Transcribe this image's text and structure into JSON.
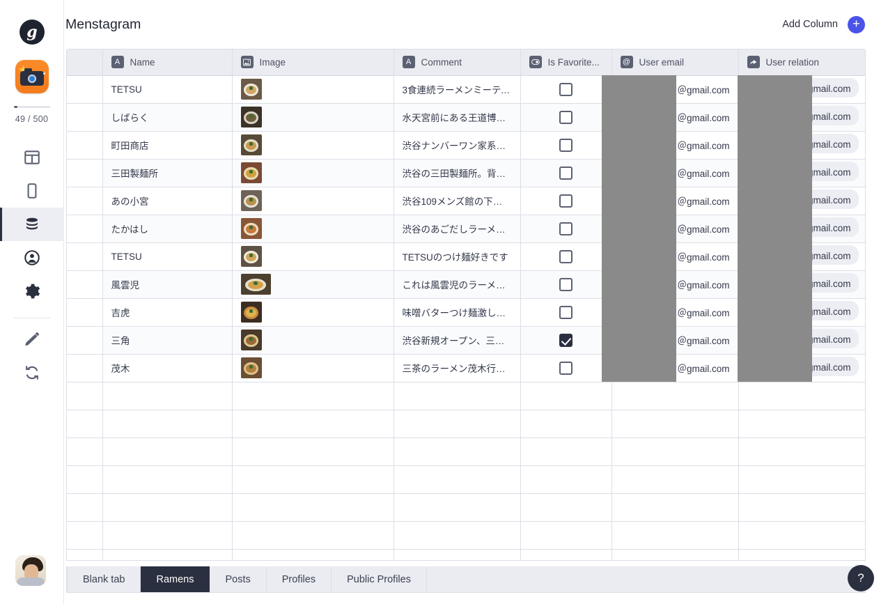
{
  "sidebar": {
    "brand_logo_letter": "g",
    "app_icon_name": "camera-app-icon",
    "quota": {
      "label": "49 / 500",
      "used": 49,
      "total": 500,
      "percent": 9.8
    },
    "nav_items": [
      {
        "name": "layout",
        "label": "Layout",
        "active": false
      },
      {
        "name": "mobile",
        "label": "Mobile preview",
        "active": false
      },
      {
        "name": "database",
        "label": "Database",
        "active": true
      },
      {
        "name": "users",
        "label": "Users",
        "active": false
      },
      {
        "name": "settings",
        "label": "Settings",
        "active": false
      },
      {
        "name": "design",
        "label": "Design",
        "active": false
      },
      {
        "name": "refresh",
        "label": "Refresh",
        "active": false
      }
    ],
    "avatar_label": "User avatar"
  },
  "header": {
    "title": "Menstagram",
    "add_column_label": "Add Column",
    "add_column_icon": "plus-icon"
  },
  "table": {
    "columns": [
      {
        "key": "gutter",
        "label": "",
        "icon": ""
      },
      {
        "key": "name",
        "label": "Name",
        "icon": "text-type-icon",
        "glyph": "A"
      },
      {
        "key": "image",
        "label": "Image",
        "icon": "image-type-icon",
        "glyph": "⛰"
      },
      {
        "key": "comment",
        "label": "Comment",
        "icon": "text-type-icon",
        "glyph": "A"
      },
      {
        "key": "fav",
        "label": "Is Favorite...",
        "icon": "toggle-type-icon",
        "glyph": "◉"
      },
      {
        "key": "email",
        "label": "User email",
        "icon": "email-type-icon",
        "glyph": "@"
      },
      {
        "key": "rel",
        "label": "User relation",
        "icon": "relation-type-icon",
        "glyph": "↱"
      }
    ],
    "rows": [
      {
        "name": "TETSU",
        "comment": "3食連続ラーメンミーティ…",
        "favorite": false,
        "email": "＠gmail.com",
        "relation": "＠gmail.com",
        "thumb_wide": false
      },
      {
        "name": "しばらく",
        "comment": "水天宮前にある王道博多…",
        "favorite": false,
        "email": "＠gmail.com",
        "relation": "＠gmail.com",
        "thumb_wide": false
      },
      {
        "name": "町田商店",
        "comment": "渋谷ナンバーワン家系ラー…",
        "favorite": false,
        "email": "＠gmail.com",
        "relation": "＠gmail.com",
        "thumb_wide": false
      },
      {
        "name": "三田製麺所",
        "comment": "渋谷の三田製麺所。背脂…",
        "favorite": false,
        "email": "＠gmail.com",
        "relation": "＠gmail.com",
        "thumb_wide": false
      },
      {
        "name": "あの小宮",
        "comment": "渋谷109メンズ館の下に出…",
        "favorite": false,
        "email": "＠gmail.com",
        "relation": "＠gmail.com",
        "thumb_wide": false
      },
      {
        "name": "たかはし",
        "comment": "渋谷のあごだしラーメン2…",
        "favorite": false,
        "email": "＠gmail.com",
        "relation": "＠gmail.com",
        "thumb_wide": false
      },
      {
        "name": "TETSU",
        "comment": "TETSUのつけ麺好きです",
        "favorite": false,
        "email": "＠gmail.com",
        "relation": "＠gmail.com",
        "thumb_wide": false
      },
      {
        "name": "風雲児",
        "comment": "これは風雲児のラーメン…",
        "favorite": false,
        "email": "＠gmail.com",
        "relation": "＠gmail.com",
        "thumb_wide": true
      },
      {
        "name": "吉虎",
        "comment": "味噌バターつけ麺激しょ…",
        "favorite": false,
        "email": "＠gmail.com",
        "relation": "＠gmail.com",
        "thumb_wide": false
      },
      {
        "name": "三角",
        "comment": "渋谷新規オープン、三角の…",
        "favorite": true,
        "email": "＠gmail.com",
        "relation": "＠gmail.com",
        "thumb_wide": false
      },
      {
        "name": "茂木",
        "comment": "三茶のラーメン茂木行って…",
        "favorite": false,
        "email": "＠gmail.com",
        "relation": "＠gmail.com",
        "thumb_wide": false
      }
    ],
    "empty_row_count": 7
  },
  "tabs": {
    "items": [
      {
        "label": "Blank tab",
        "active": false
      },
      {
        "label": "Ramens",
        "active": true
      },
      {
        "label": "Posts",
        "active": false
      },
      {
        "label": "Profiles",
        "active": false
      },
      {
        "label": "Public Profiles",
        "active": false
      }
    ]
  },
  "help": {
    "label": "?"
  },
  "colors": {
    "accent_blue": "#4a53e8",
    "app_icon_orange": "#f37b1c",
    "dark": "#2b3040",
    "header_bg": "#eaecf1",
    "border": "#dcdee6",
    "redaction_gray": "#8a8a8a"
  }
}
